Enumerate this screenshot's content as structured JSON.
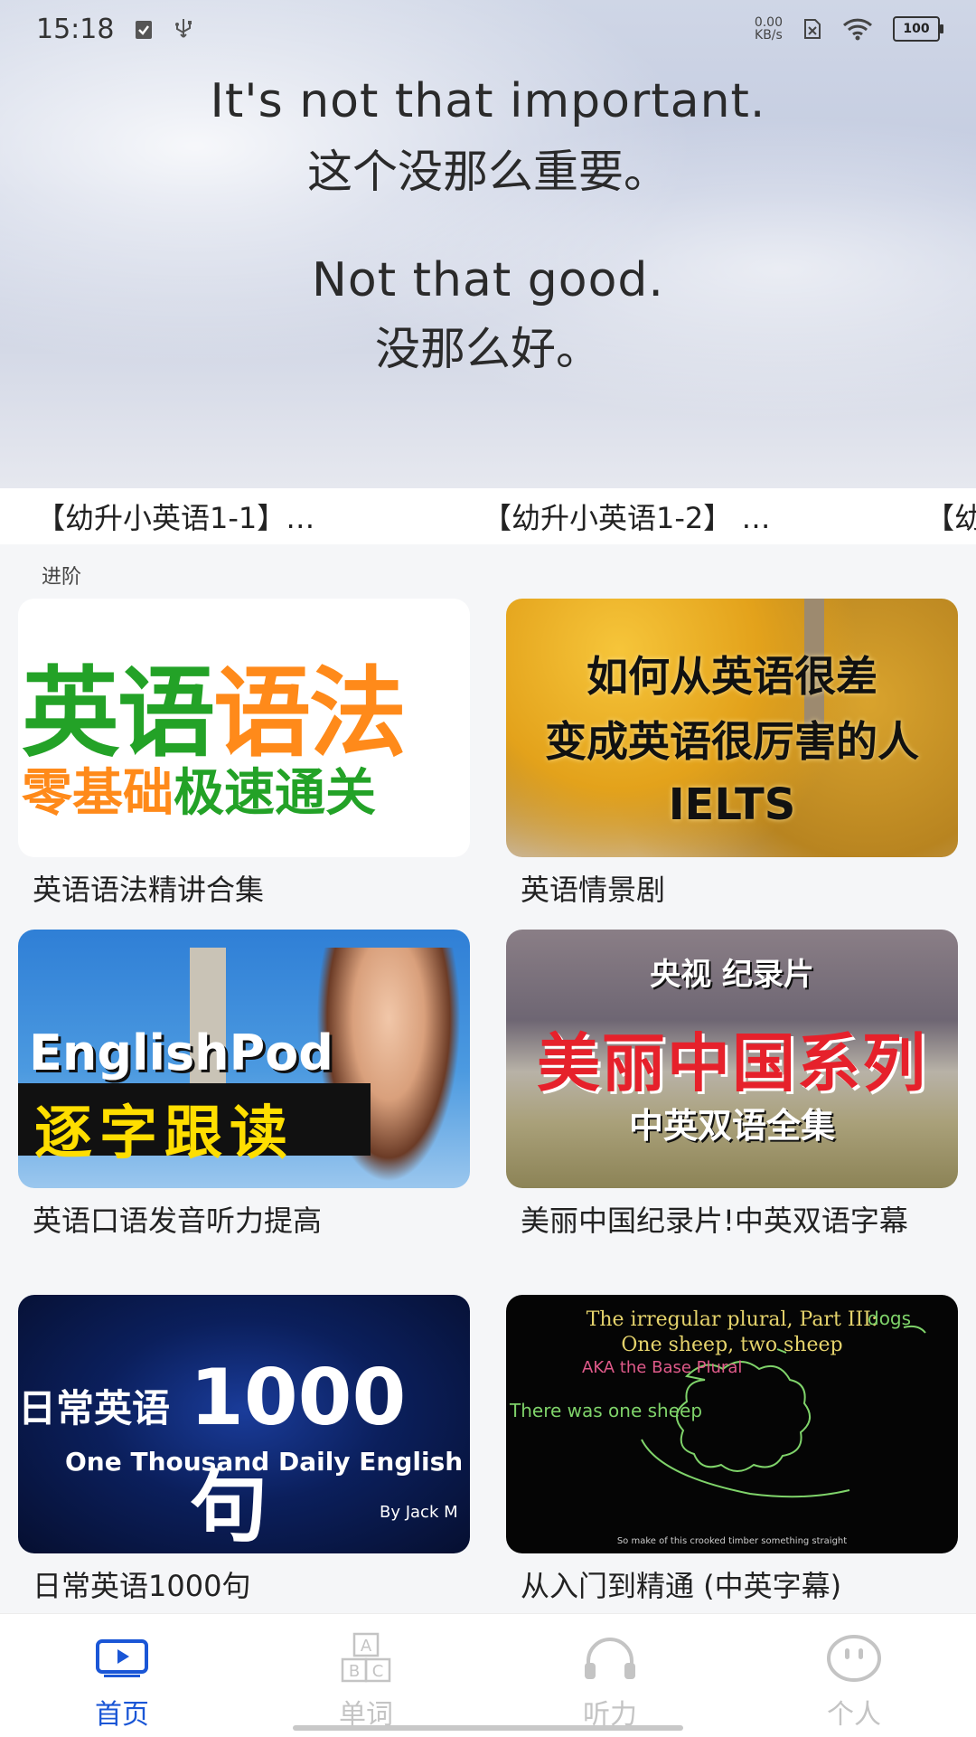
{
  "status_bar": {
    "time": "15:18",
    "net_speed_top": "0.00",
    "net_speed_bottom": "KB/s",
    "battery": "100"
  },
  "hero": {
    "line1_en": "It's not that important.",
    "line1_zh": "这个没那么重要。",
    "line2_en": "Not that good.",
    "line2_zh": "没那么好。"
  },
  "strip": {
    "items": [
      "【幼升小英语1-1】…",
      "【幼升小英语1-2】 …",
      "【幼"
    ]
  },
  "section": {
    "label": "进阶"
  },
  "cards": [
    {
      "title": "英语语法精讲合集",
      "thumb_line1a": "英语",
      "thumb_line1b": "语法",
      "thumb_line2a": "零基础",
      "thumb_line2b": "极速通关"
    },
    {
      "title": "英语情景剧",
      "thumb_line1": "如何从英语很差",
      "thumb_line2": "变成英语很厉害的人",
      "thumb_line3": "IELTS"
    },
    {
      "title": "英语口语发音听力提高",
      "thumb_line1": "EnglishPod",
      "thumb_line2": "逐字跟读"
    },
    {
      "title": "美丽中国纪录片!中英双语字幕",
      "thumb_line1": "央视 纪录片",
      "thumb_line2": "美丽中国系列",
      "thumb_line3": "中英双语全集"
    },
    {
      "title": "日常英语1000句",
      "thumb_line1a": "日常英语",
      "thumb_line1b": "1000句",
      "thumb_line2": "One Thousand Daily English",
      "thumb_line3": "By Jack M"
    },
    {
      "title": "从入门到精通 (中英字幕)",
      "thumb_line1": "The irregular plural, Part III:",
      "thumb_line2": "One sheep, two sheep",
      "thumb_line3": "AKA the Base Plural",
      "thumb_line4": "There was one sheep",
      "thumb_line5": "dogs",
      "thumb_line6": "So make of this crooked timber something straight"
    }
  ],
  "nav": {
    "items": [
      {
        "label": "首页",
        "icon": "play-video-icon",
        "active": true
      },
      {
        "label": "单词",
        "icon": "abc-blocks-icon",
        "active": false
      },
      {
        "label": "听力",
        "icon": "headphones-icon",
        "active": false
      },
      {
        "label": "个人",
        "icon": "smiley-face-icon",
        "active": false
      }
    ]
  },
  "colors": {
    "accent": "#1a56d6",
    "inactive": "#c4c4c4",
    "green": "#23a227",
    "orange": "#ff8a1a"
  }
}
